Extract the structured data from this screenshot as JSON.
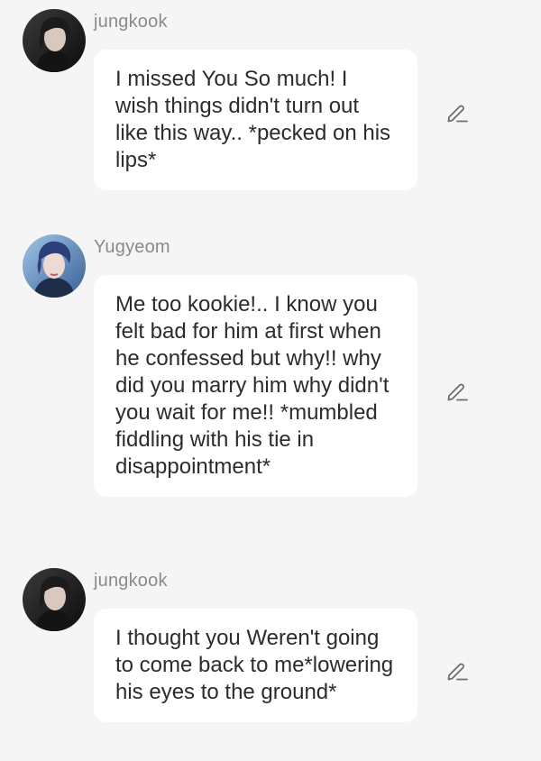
{
  "messages": [
    {
      "author": "jungkook",
      "avatar_icon": "dark-haired-avatar",
      "text": "I missed You So much! I wish things didn't turn out like this way.. *pecked on his lips*"
    },
    {
      "author": "Yugyeom",
      "avatar_icon": "blue-haired-avatar",
      "text": "Me too kookie!.. I know you felt bad for him at first when he confessed but why!! why did you marry him why didn't you wait for me!! *mumbled fiddling with his tie in disappointment*"
    },
    {
      "author": "jungkook",
      "avatar_icon": "dark-haired-avatar",
      "text": "I thought you Weren't going to come back to me*lowering his eyes to the ground*"
    }
  ],
  "colors": {
    "background": "#f5f5f5",
    "bubble": "#ffffff",
    "author_text": "#8a8a8a",
    "message_text": "#2c2c2c",
    "edit_icon": "#6e6e6e"
  },
  "icons": {
    "edit": "pencil-edit-icon"
  }
}
